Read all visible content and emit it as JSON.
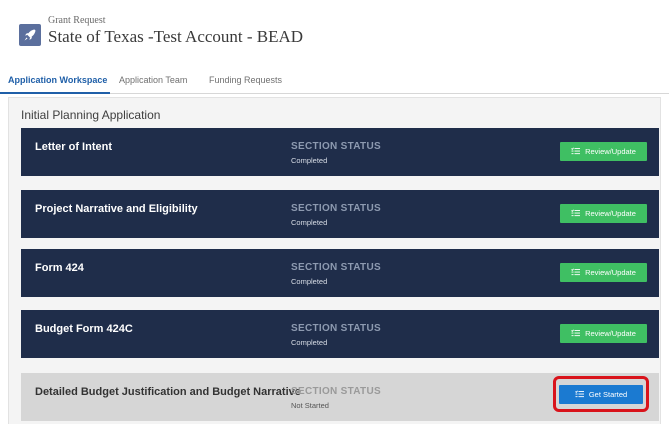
{
  "header": {
    "subtitle": "Grant Request",
    "title": "State of Texas -Test Account - BEAD",
    "icon": "rocket-icon",
    "icon_color": "#5b6f9d"
  },
  "tabs": [
    {
      "label": "Application Workspace",
      "active": true
    },
    {
      "label": "Application Team",
      "active": false
    },
    {
      "label": "Funding Requests",
      "active": false
    }
  ],
  "workspace": {
    "title": "Initial Planning Application",
    "status_label": "SECTION STATUS",
    "sections": [
      {
        "name": "Letter of Intent",
        "status": "Completed",
        "action": "Review/Update"
      },
      {
        "name": "Project Narrative and Eligibility",
        "status": "Completed",
        "action": "Review/Update"
      },
      {
        "name": "Form 424",
        "status": "Completed",
        "action": "Review/Update"
      },
      {
        "name": "Budget Form 424C",
        "status": "Completed",
        "action": "Review/Update"
      },
      {
        "name": "Detailed Budget Justification and Budget Narrative",
        "status": "Not Started",
        "action": "Get Started"
      }
    ]
  },
  "colors": {
    "section_dark": "#1f2d4a",
    "section_light": "#d6d6d6",
    "review_button": "#3fbf63",
    "start_button": "#1b7ad1",
    "highlight": "#d9131b",
    "active_tab": "#1f5fa8"
  }
}
